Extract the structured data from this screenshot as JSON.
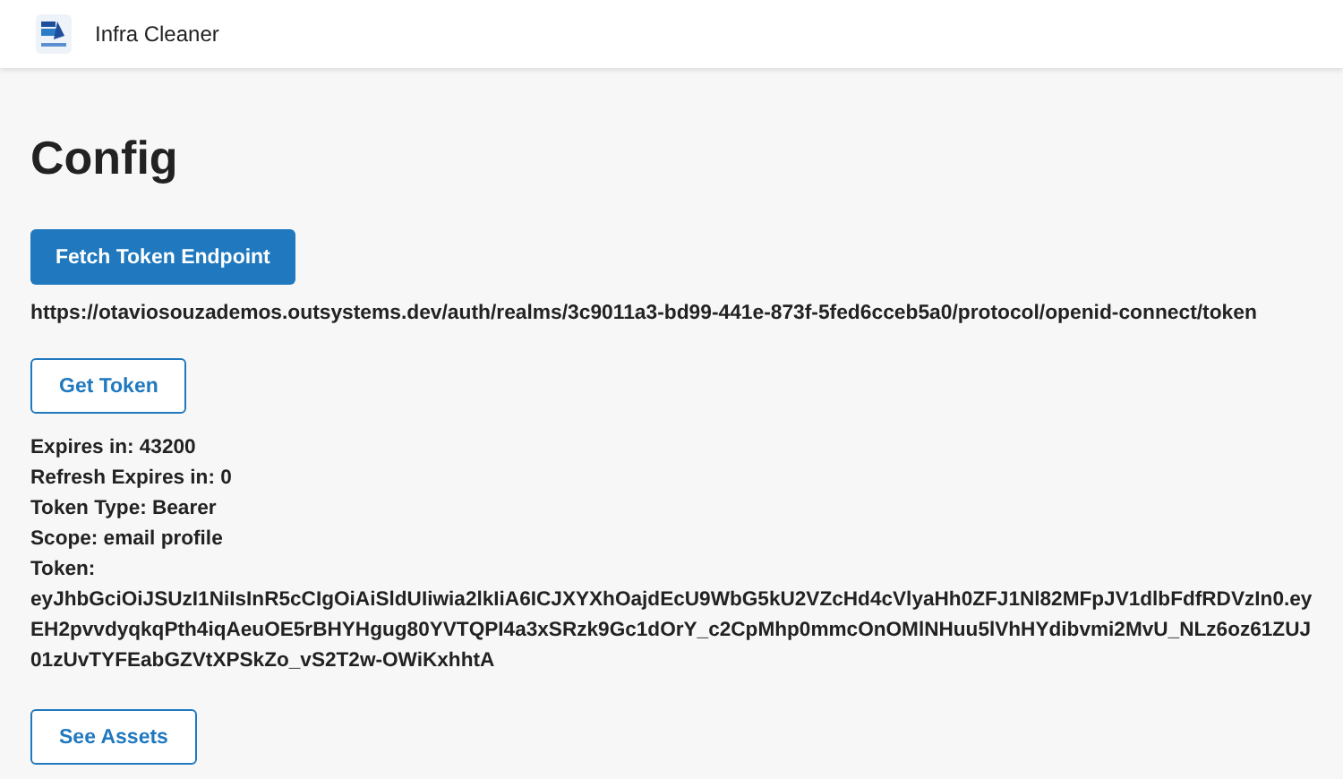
{
  "header": {
    "app_name": "Infra Cleaner"
  },
  "page": {
    "title": "Config"
  },
  "fetch_button": "Fetch Token Endpoint",
  "endpoint_url": "https://otaviosouzademos.outsystems.dev/auth/realms/3c9011a3-bd99-441e-873f-5fed6cceb5a0/protocol/openid-connect/token",
  "get_token_button": "Get Token",
  "token_info": [
    "Expires in: 43200",
    "Refresh Expires in: 0",
    "Token Type: Bearer",
    "Scope: email profile",
    "Token:"
  ],
  "token_lines": [
    "eyJhbGciOiJSUzI1NiIsInR5cCIgOiAiSldUIiwia2lkIiA6ICJXYXhOajdEcU9WbG5kU2VZcHd4cVlyaHh0ZFJ1Nl82MFpJV1dlbFdfRDVzIn0.ey",
    "EH2pvvdyqkqPth4iqAeuOE5rBHYHgug80YVTQPI4a3xSRzk9Gc1dOrY_c2CpMhp0mmcOnOMlNHuu5lVhHYdibvmi2MvU_NLz6oz61ZUJ",
    "01zUvTYFEabGZVtXPSkZo_vS2T2w-OWiKxhhtA"
  ],
  "see_assets_button": "See Assets"
}
